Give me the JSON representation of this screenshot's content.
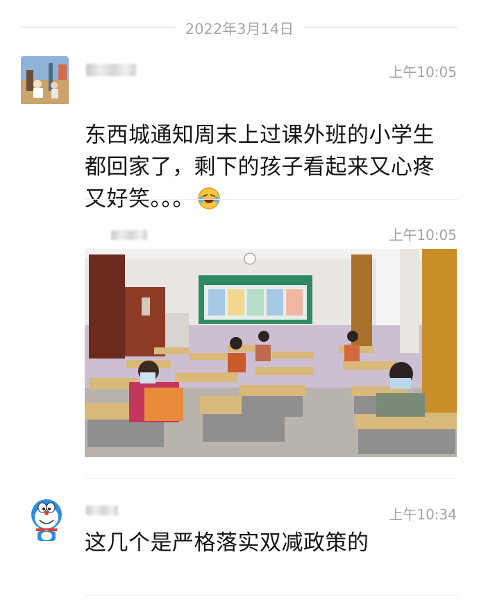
{
  "date_header": "2022年3月14日",
  "messages": [
    {
      "time": "上午10:05",
      "text": "东西城通知周末上过课外班的小学生\n都回家了，剩下的孩子看起来又心疼\n又好笑。。。",
      "emoji": "laughing-crying-emoji"
    },
    {
      "time": "上午10:05",
      "image": "classroom-photo"
    },
    {
      "time": "上午10:34",
      "text": "这几个是严格落实双减政策的"
    }
  ],
  "colors": {
    "meta_text": "#a3a3a3",
    "divider": "#ececec",
    "message_text": "#141414"
  }
}
